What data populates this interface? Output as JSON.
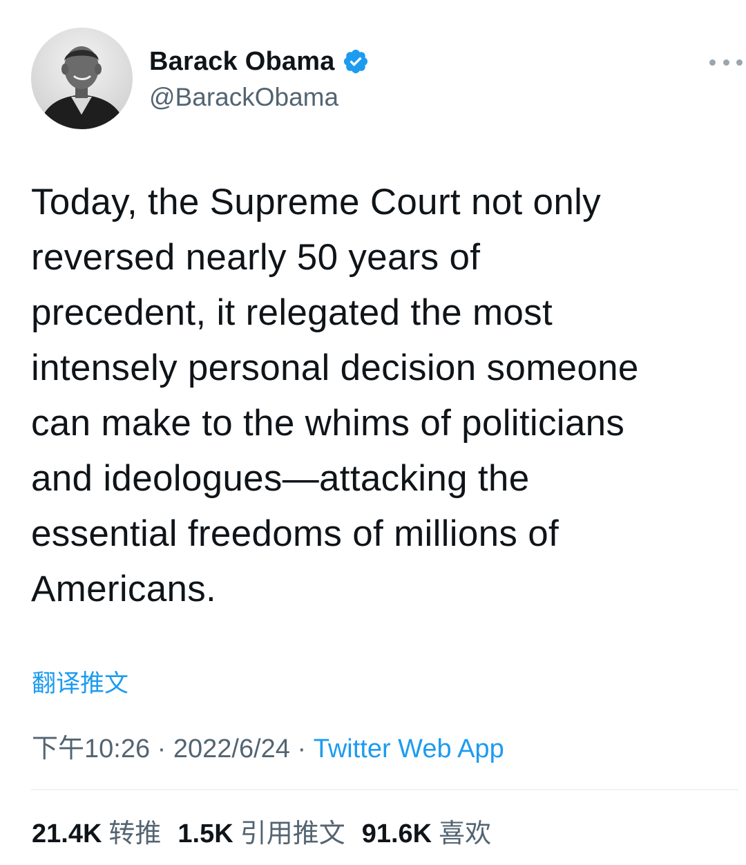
{
  "author": {
    "display_name": "Barack Obama",
    "handle": "@BarackObama",
    "verified": true,
    "verified_color": "#1d9bf0"
  },
  "tweet": {
    "lines": [
      "Today, the Supreme Court not only",
      "reversed nearly 50 years of",
      "precedent, it relegated the most",
      "intensely personal decision someone",
      "can make to the whims of politicians",
      "and ideologues—attacking the",
      "essential freedoms of millions of",
      "Americans."
    ]
  },
  "translate_label": "翻译推文",
  "meta": {
    "time": "下午10:26",
    "separator": " · ",
    "date": "2022/6/24",
    "source": "Twitter Web App"
  },
  "stats": {
    "retweets": {
      "count": "21.4K",
      "label": "转推"
    },
    "quotes": {
      "count": "1.5K",
      "label": "引用推文"
    },
    "likes": {
      "count": "91.6K",
      "label": "喜欢"
    }
  },
  "icons": {
    "more": "more-horizontal-icon",
    "verified": "verified-badge-icon"
  },
  "colors": {
    "accent": "#1d9bf0",
    "secondary_text": "#536471",
    "primary_text": "#0f1419"
  }
}
